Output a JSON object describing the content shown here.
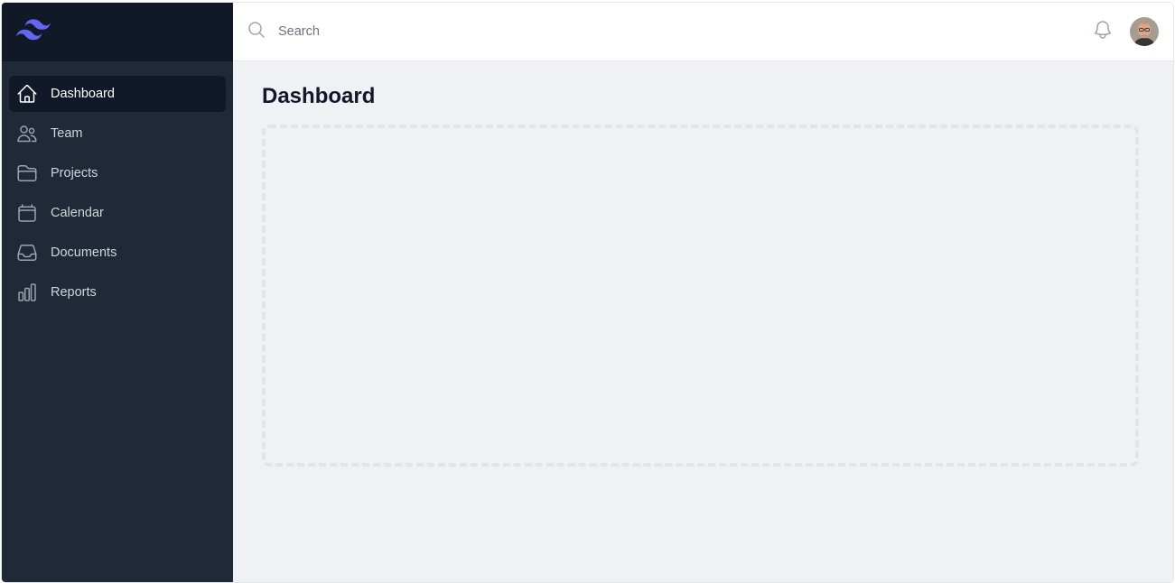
{
  "app": {
    "logo_icon": "tailwind-wave-logo",
    "accent_color": "#6366f1"
  },
  "sidebar": {
    "items": [
      {
        "label": "Dashboard",
        "icon": "home-icon",
        "active": true
      },
      {
        "label": "Team",
        "icon": "users-icon",
        "active": false
      },
      {
        "label": "Projects",
        "icon": "folder-icon",
        "active": false
      },
      {
        "label": "Calendar",
        "icon": "calendar-icon",
        "active": false
      },
      {
        "label": "Documents",
        "icon": "inbox-icon",
        "active": false
      },
      {
        "label": "Reports",
        "icon": "chart-bar-icon",
        "active": false
      }
    ]
  },
  "header": {
    "search": {
      "placeholder": "Search",
      "value": ""
    },
    "notification_icon": "bell-icon",
    "avatar_icon": "user-avatar"
  },
  "main": {
    "title": "Dashboard"
  },
  "colors": {
    "sidebar_bg": "#1f2937",
    "logo_bar_bg": "#111827",
    "main_bg": "#f0f1f5"
  }
}
